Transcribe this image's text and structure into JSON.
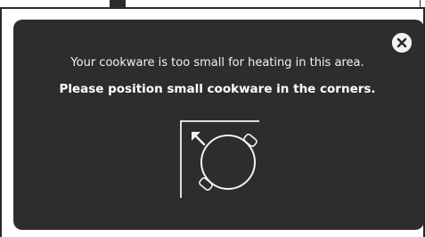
{
  "dialog": {
    "message": "Your cookware is too small for heating in this area.",
    "instruction": "Please position small cookware in the corners."
  },
  "icons": {
    "close": "close-circle-icon",
    "corner_guide": "corner-pan-icon",
    "arrow": "arrow-up-left-icon",
    "pan": "pan-icon"
  },
  "colors": {
    "dialog_background": "#2d2d2d",
    "text": "#f2f2f2",
    "close_fill": "#f4f4f4",
    "close_glyph": "#2d2d2d"
  }
}
